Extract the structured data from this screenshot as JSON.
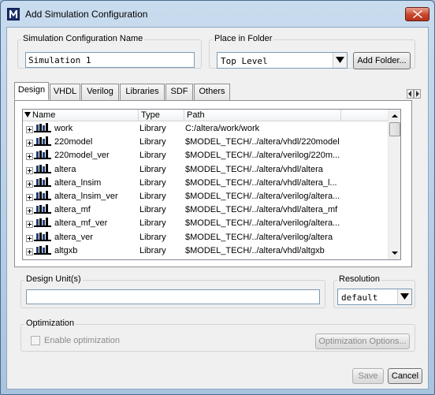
{
  "window": {
    "title": "Add Simulation Configuration",
    "close_label": "close"
  },
  "sim_config": {
    "group_label": "Simulation Configuration Name",
    "name_value": "Simulation 1"
  },
  "folder": {
    "group_label": "Place in Folder",
    "selected": "Top Level",
    "add_button": "Add Folder..."
  },
  "tabs": [
    {
      "label": "Design"
    },
    {
      "label": "VHDL"
    },
    {
      "label": "Verilog"
    },
    {
      "label": "Libraries"
    },
    {
      "label": "SDF"
    },
    {
      "label": "Others"
    }
  ],
  "active_tab": "Design",
  "library_list": {
    "columns": {
      "name": "Name",
      "type": "Type",
      "path": "Path"
    },
    "rows": [
      {
        "name": "work",
        "type": "Library",
        "path": "C:/altera/work/work"
      },
      {
        "name": "220model",
        "type": "Library",
        "path": "$MODEL_TECH/../altera/vhdl/220model"
      },
      {
        "name": "220model_ver",
        "type": "Library",
        "path": "$MODEL_TECH/../altera/verilog/220m..."
      },
      {
        "name": "altera",
        "type": "Library",
        "path": "$MODEL_TECH/../altera/vhdl/altera"
      },
      {
        "name": "altera_lnsim",
        "type": "Library",
        "path": "$MODEL_TECH/../altera/vhdl/altera_l..."
      },
      {
        "name": "altera_lnsim_ver",
        "type": "Library",
        "path": "$MODEL_TECH/../altera/verilog/altera..."
      },
      {
        "name": "altera_mf",
        "type": "Library",
        "path": "$MODEL_TECH/../altera/vhdl/altera_mf"
      },
      {
        "name": "altera_mf_ver",
        "type": "Library",
        "path": "$MODEL_TECH/../altera/verilog/altera..."
      },
      {
        "name": "altera_ver",
        "type": "Library",
        "path": "$MODEL_TECH/../altera/verilog/altera"
      },
      {
        "name": "altgxb",
        "type": "Library",
        "path": "$MODEL_TECH/../altera/vhdl/altgxb"
      }
    ]
  },
  "design_unit": {
    "group_label": "Design Unit(s)",
    "value": ""
  },
  "resolution": {
    "group_label": "Resolution",
    "selected": "default"
  },
  "optimization": {
    "group_label": "Optimization",
    "enable_label": "Enable optimization",
    "options_button": "Optimization Options..."
  },
  "footer": {
    "save_label": "Save",
    "cancel_label": "Cancel"
  },
  "icons": {
    "app": "modelsim-icon",
    "library": "library-icon",
    "expand": "plus-expander-icon",
    "dropdown": "down-arrow-icon"
  }
}
